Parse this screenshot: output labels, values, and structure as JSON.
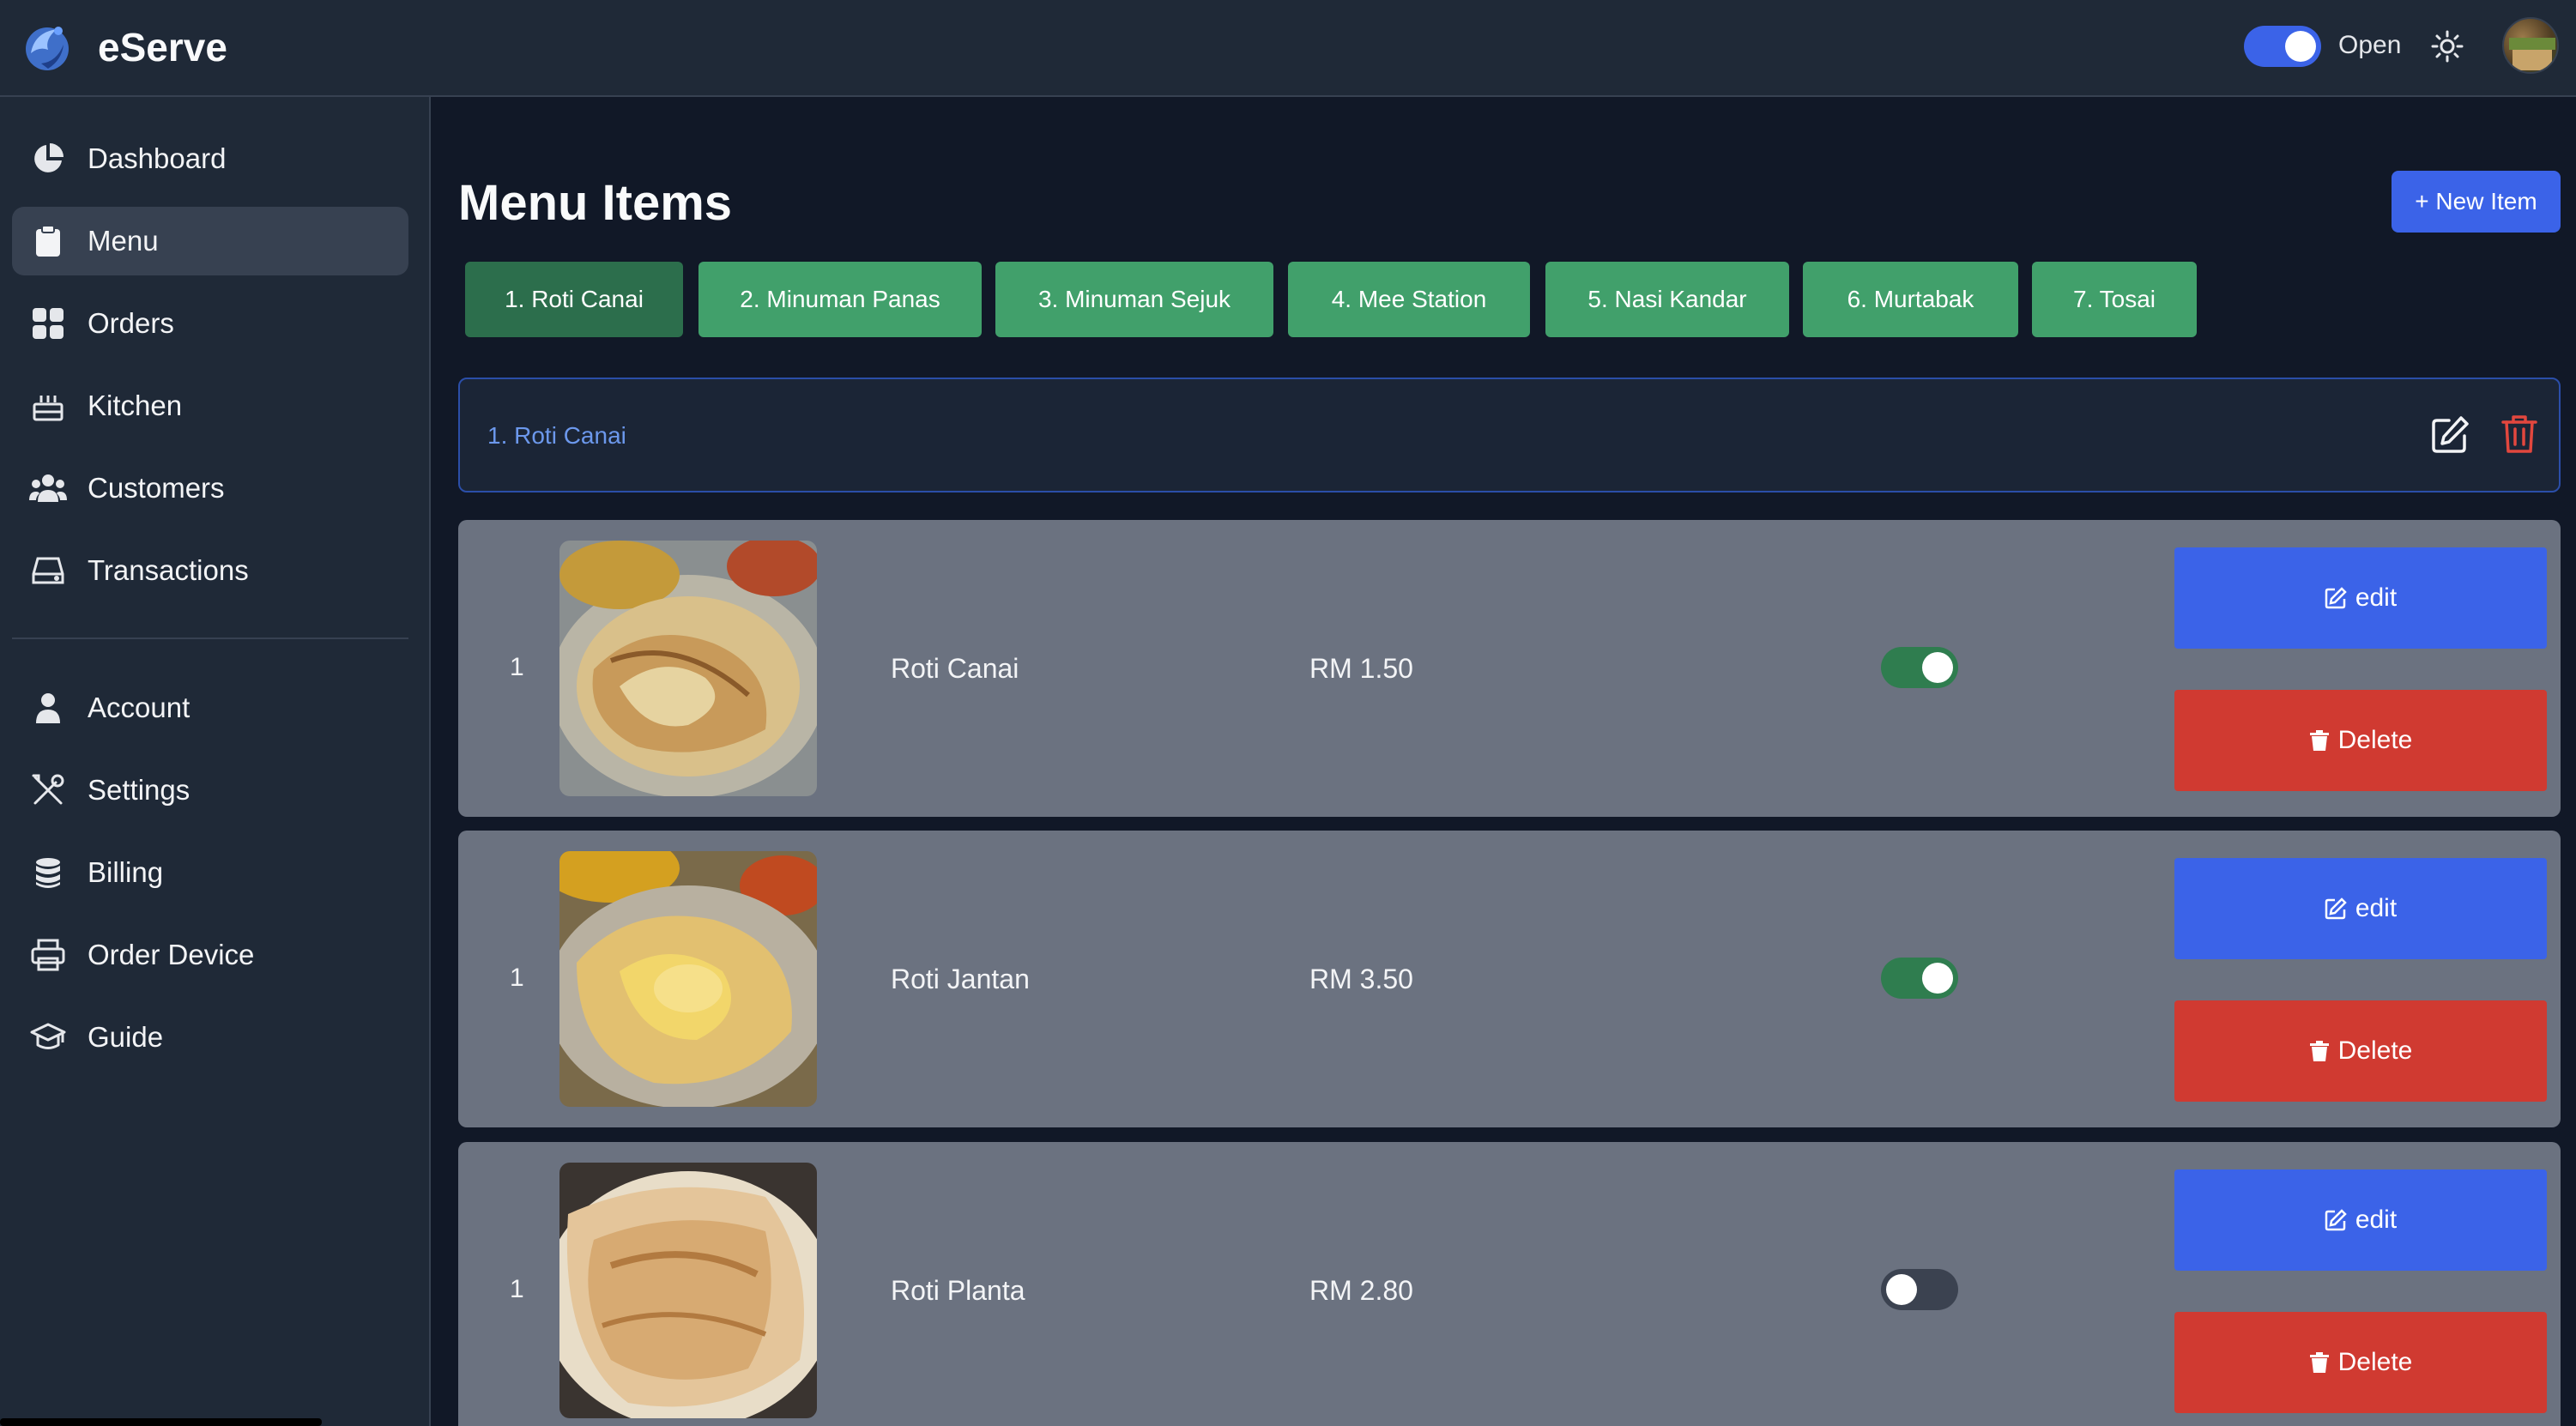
{
  "app": {
    "name": "eServe"
  },
  "header": {
    "status_label": "Open",
    "status_on": true
  },
  "sidebar": {
    "items": [
      {
        "label": "Dashboard",
        "icon": "pie-chart-icon",
        "active": false
      },
      {
        "label": "Menu",
        "icon": "clipboard-icon",
        "active": true
      },
      {
        "label": "Orders",
        "icon": "grid-icon",
        "active": false
      },
      {
        "label": "Kitchen",
        "icon": "cake-icon",
        "active": false
      },
      {
        "label": "Customers",
        "icon": "users-icon",
        "active": false
      },
      {
        "label": "Transactions",
        "icon": "hard-drive-icon",
        "active": false
      }
    ],
    "secondary_items": [
      {
        "label": "Account",
        "icon": "user-icon"
      },
      {
        "label": "Settings",
        "icon": "tools-icon"
      },
      {
        "label": "Billing",
        "icon": "coins-icon"
      },
      {
        "label": "Order Device",
        "icon": "printer-icon"
      },
      {
        "label": "Guide",
        "icon": "graduation-cap-icon"
      }
    ]
  },
  "main": {
    "title": "Menu Items",
    "new_item_label": "+ New Item",
    "categories": [
      "1. Roti Canai",
      "2. Minuman Panas",
      "3. Minuman Sejuk",
      "4. Mee Station",
      "5. Nasi Kandar",
      "6. Murtabak",
      "7. Tosai"
    ],
    "selected_category": "1. Roti Canai",
    "items": [
      {
        "index": "1",
        "name": "Roti Canai",
        "price": "RM 1.50",
        "available": true,
        "edit_label": "edit",
        "delete_label": "Delete"
      },
      {
        "index": "1",
        "name": "Roti Jantan",
        "price": "RM 3.50",
        "available": true,
        "edit_label": "edit",
        "delete_label": "Delete"
      },
      {
        "index": "1",
        "name": "Roti Planta",
        "price": "RM 2.80",
        "available": false,
        "edit_label": "edit",
        "delete_label": "Delete"
      }
    ]
  },
  "colors": {
    "accent": "#3b63e8",
    "category_tab": "#41a06b",
    "category_tab_active": "#2c6e4c",
    "delete": "#d03a31",
    "row_bg": "#6b7280"
  }
}
